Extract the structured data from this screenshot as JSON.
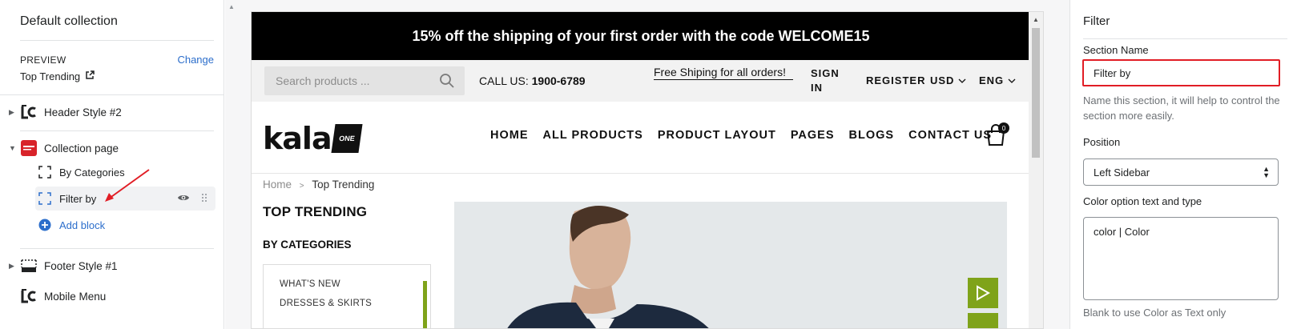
{
  "sidebar": {
    "collection_title": "Default collection",
    "preview_label": "PREVIEW",
    "change_label": "Change",
    "preview_value": "Top Trending",
    "sections": [
      {
        "label": "Header Style #2"
      },
      {
        "label": "Collection page"
      },
      {
        "label": "Footer Style #1"
      },
      {
        "label": "Mobile Menu"
      }
    ],
    "blocks": [
      {
        "label": "By Categories"
      },
      {
        "label": "Filter by"
      }
    ],
    "add_block_label": "Add block"
  },
  "preview": {
    "announcement": "15% off the shipping of your first order with the code WELCOME15",
    "search_placeholder": "Search products ...",
    "call_label": "CALL US:",
    "call_number": "1900-6789",
    "free_shipping": "Free Shiping for all orders!",
    "sign_in_line1": "SIGN",
    "sign_in_line2": "IN",
    "register": "REGISTER",
    "currency": "USD",
    "language": "ENG",
    "logo_text": "kala",
    "logo_badge": "ONE",
    "nav": [
      "HOME",
      "ALL PRODUCTS",
      "PRODUCT LAYOUT",
      "PAGES",
      "BLOGS",
      "CONTACT US"
    ],
    "cart_count": "0",
    "breadcrumb_home": "Home",
    "breadcrumb_current": "Top Trending",
    "page_title": "TOP TRENDING",
    "by_categories": "BY CATEGORIES",
    "categories": [
      "WHAT'S NEW",
      "DRESSES & SKIRTS"
    ],
    "accent_color": "#7fa31a"
  },
  "settings": {
    "panel_title": "Filter",
    "section_name_label": "Section Name",
    "section_name_value": "Filter by",
    "section_name_help": "Name this section, it will help to control the section more easily.",
    "position_label": "Position",
    "position_value": "Left Sidebar",
    "color_option_label": "Color option text and type",
    "color_option_value": "color | Color",
    "color_option_help": "Blank to use Color as Text only"
  }
}
